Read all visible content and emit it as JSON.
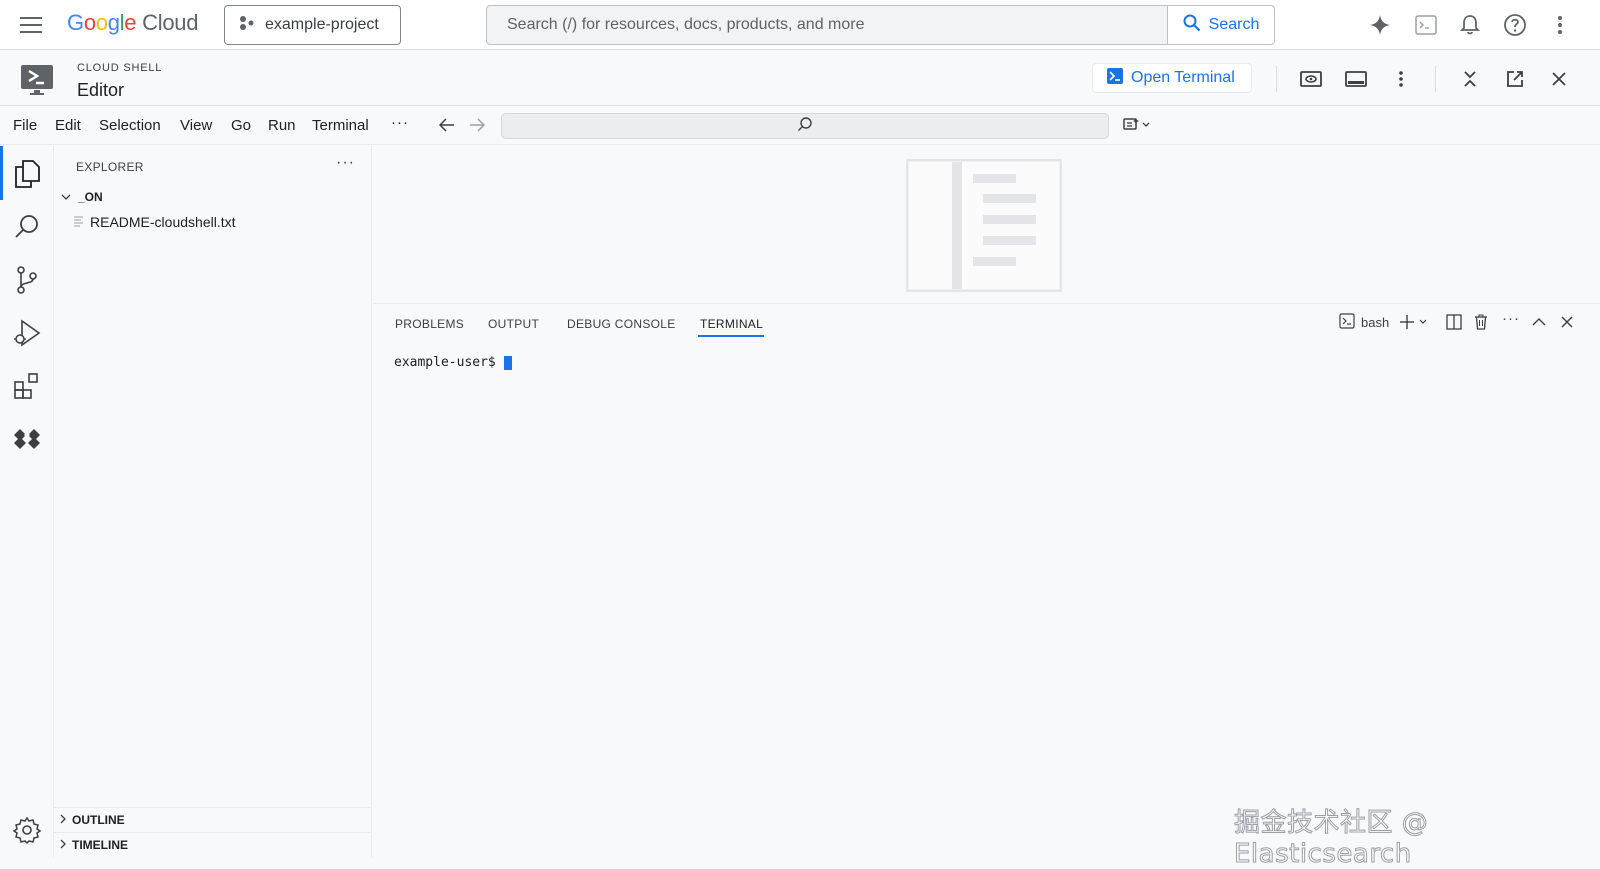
{
  "topbar": {
    "logo_parts": [
      "G",
      "o",
      "o",
      "g",
      "l",
      "e"
    ],
    "logo_cloud": "Cloud",
    "project": "example-project",
    "search_placeholder": "Search (/) for resources, docs, products, and more",
    "search_button": "Search"
  },
  "cloudshell": {
    "label": "CLOUD SHELL",
    "title": "Editor",
    "open_terminal": "Open Terminal"
  },
  "menubar": {
    "items": [
      "File",
      "Edit",
      "Selection",
      "View",
      "Go",
      "Run",
      "Terminal"
    ],
    "more": "···"
  },
  "explorer": {
    "title": "EXPLORER",
    "more": "···",
    "folder": "_ON",
    "files": [
      "README-cloudshell.txt"
    ],
    "outline": "OUTLINE",
    "timeline": "TIMELINE"
  },
  "panel": {
    "tabs": [
      "PROBLEMS",
      "OUTPUT",
      "DEBUG CONSOLE",
      "TERMINAL"
    ],
    "active_tab": "TERMINAL",
    "shell": "bash",
    "more": "···",
    "prompt": "example-user$"
  },
  "watermark": "掘金技术社区 @ Elasticsearch",
  "colors": {
    "accent": "#1a73e8",
    "background": "#f8f9fa"
  }
}
